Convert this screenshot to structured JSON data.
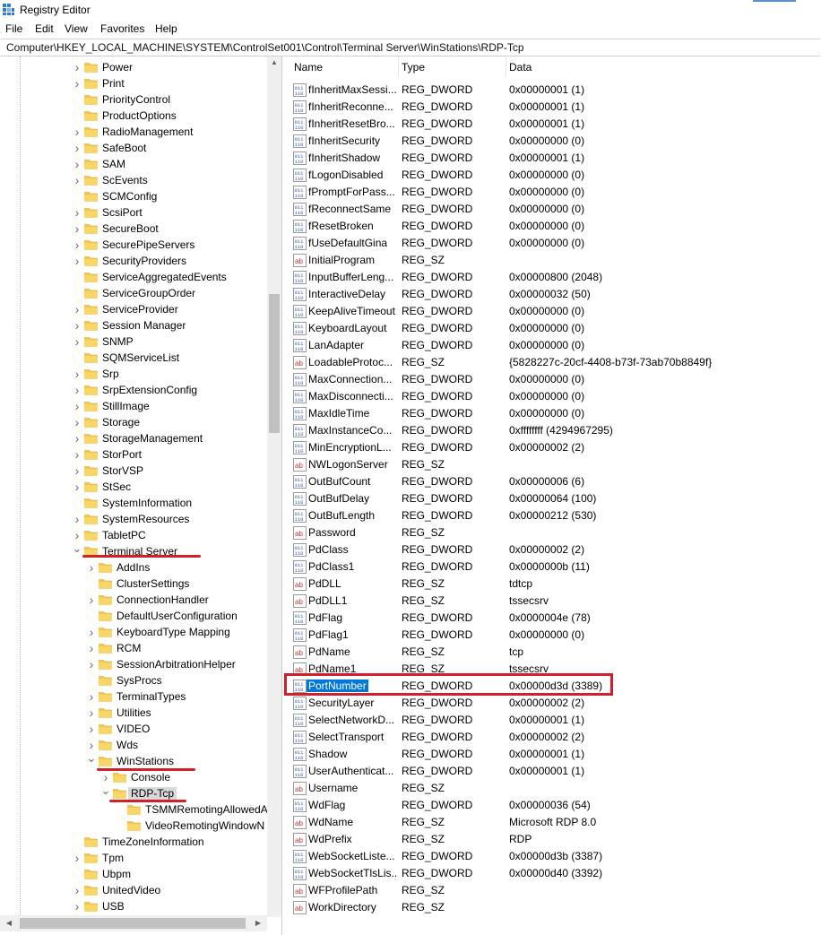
{
  "window": {
    "title": "Registry Editor"
  },
  "menu": [
    "File",
    "Edit",
    "View",
    "Favorites",
    "Help"
  ],
  "address": "Computer\\HKEY_LOCAL_MACHINE\\SYSTEM\\ControlSet001\\Control\\Terminal Server\\WinStations\\RDP-Tcp",
  "tree": [
    {
      "label": "Power",
      "level": 0,
      "chev": "right"
    },
    {
      "label": "Print",
      "level": 0,
      "chev": "right"
    },
    {
      "label": "PriorityControl",
      "level": 0,
      "chev": "none"
    },
    {
      "label": "ProductOptions",
      "level": 0,
      "chev": "none"
    },
    {
      "label": "RadioManagement",
      "level": 0,
      "chev": "right"
    },
    {
      "label": "SafeBoot",
      "level": 0,
      "chev": "right"
    },
    {
      "label": "SAM",
      "level": 0,
      "chev": "right"
    },
    {
      "label": "ScEvents",
      "level": 0,
      "chev": "right"
    },
    {
      "label": "SCMConfig",
      "level": 0,
      "chev": "none"
    },
    {
      "label": "ScsiPort",
      "level": 0,
      "chev": "right"
    },
    {
      "label": "SecureBoot",
      "level": 0,
      "chev": "right"
    },
    {
      "label": "SecurePipeServers",
      "level": 0,
      "chev": "right"
    },
    {
      "label": "SecurityProviders",
      "level": 0,
      "chev": "right"
    },
    {
      "label": "ServiceAggregatedEvents",
      "level": 0,
      "chev": "none"
    },
    {
      "label": "ServiceGroupOrder",
      "level": 0,
      "chev": "none"
    },
    {
      "label": "ServiceProvider",
      "level": 0,
      "chev": "right"
    },
    {
      "label": "Session Manager",
      "level": 0,
      "chev": "right"
    },
    {
      "label": "SNMP",
      "level": 0,
      "chev": "right"
    },
    {
      "label": "SQMServiceList",
      "level": 0,
      "chev": "none"
    },
    {
      "label": "Srp",
      "level": 0,
      "chev": "right"
    },
    {
      "label": "SrpExtensionConfig",
      "level": 0,
      "chev": "right"
    },
    {
      "label": "StillImage",
      "level": 0,
      "chev": "right"
    },
    {
      "label": "Storage",
      "level": 0,
      "chev": "right"
    },
    {
      "label": "StorageManagement",
      "level": 0,
      "chev": "right"
    },
    {
      "label": "StorPort",
      "level": 0,
      "chev": "right"
    },
    {
      "label": "StorVSP",
      "level": 0,
      "chev": "right"
    },
    {
      "label": "StSec",
      "level": 0,
      "chev": "right"
    },
    {
      "label": "SystemInformation",
      "level": 0,
      "chev": "none"
    },
    {
      "label": "SystemResources",
      "level": 0,
      "chev": "right"
    },
    {
      "label": "TabletPC",
      "level": 0,
      "chev": "right"
    },
    {
      "label": "Terminal Server",
      "level": 0,
      "chev": "down"
    },
    {
      "label": "AddIns",
      "level": 1,
      "chev": "right"
    },
    {
      "label": "ClusterSettings",
      "level": 1,
      "chev": "none"
    },
    {
      "label": "ConnectionHandler",
      "level": 1,
      "chev": "right"
    },
    {
      "label": "DefaultUserConfiguration",
      "level": 1,
      "chev": "none"
    },
    {
      "label": "KeyboardType Mapping",
      "level": 1,
      "chev": "right"
    },
    {
      "label": "RCM",
      "level": 1,
      "chev": "right"
    },
    {
      "label": "SessionArbitrationHelper",
      "level": 1,
      "chev": "right"
    },
    {
      "label": "SysProcs",
      "level": 1,
      "chev": "none"
    },
    {
      "label": "TerminalTypes",
      "level": 1,
      "chev": "right"
    },
    {
      "label": "Utilities",
      "level": 1,
      "chev": "right"
    },
    {
      "label": "VIDEO",
      "level": 1,
      "chev": "right"
    },
    {
      "label": "Wds",
      "level": 1,
      "chev": "right"
    },
    {
      "label": "WinStations",
      "level": 1,
      "chev": "down"
    },
    {
      "label": "Console",
      "level": 2,
      "chev": "right"
    },
    {
      "label": "RDP-Tcp",
      "level": 2,
      "chev": "down",
      "selected": true
    },
    {
      "label": "TSMMRemotingAllowedA",
      "level": 3,
      "chev": "none"
    },
    {
      "label": "VideoRemotingWindowN",
      "level": 3,
      "chev": "none"
    },
    {
      "label": "TimeZoneInformation",
      "level": 0,
      "chev": "none"
    },
    {
      "label": "Tpm",
      "level": 0,
      "chev": "right"
    },
    {
      "label": "Ubpm",
      "level": 0,
      "chev": "none"
    },
    {
      "label": "UnitedVideo",
      "level": 0,
      "chev": "right"
    },
    {
      "label": "USB",
      "level": 0,
      "chev": "right"
    }
  ],
  "columns": {
    "name": "Name",
    "type": "Type",
    "data": "Data"
  },
  "values": [
    {
      "name": "fInheritMaxSessi...",
      "type": "REG_DWORD",
      "data": "0x00000001 (1)",
      "icon": "dword-icon"
    },
    {
      "name": "fInheritReconne...",
      "type": "REG_DWORD",
      "data": "0x00000001 (1)",
      "icon": "dword-icon"
    },
    {
      "name": "fInheritResetBro...",
      "type": "REG_DWORD",
      "data": "0x00000001 (1)",
      "icon": "dword-icon"
    },
    {
      "name": "fInheritSecurity",
      "type": "REG_DWORD",
      "data": "0x00000000 (0)",
      "icon": "dword-icon"
    },
    {
      "name": "fInheritShadow",
      "type": "REG_DWORD",
      "data": "0x00000001 (1)",
      "icon": "dword-icon"
    },
    {
      "name": "fLogonDisabled",
      "type": "REG_DWORD",
      "data": "0x00000000 (0)",
      "icon": "dword-icon"
    },
    {
      "name": "fPromptForPass...",
      "type": "REG_DWORD",
      "data": "0x00000000 (0)",
      "icon": "dword-icon"
    },
    {
      "name": "fReconnectSame",
      "type": "REG_DWORD",
      "data": "0x00000000 (0)",
      "icon": "dword-icon"
    },
    {
      "name": "fResetBroken",
      "type": "REG_DWORD",
      "data": "0x00000000 (0)",
      "icon": "dword-icon"
    },
    {
      "name": "fUseDefaultGina",
      "type": "REG_DWORD",
      "data": "0x00000000 (0)",
      "icon": "dword-icon"
    },
    {
      "name": "InitialProgram",
      "type": "REG_SZ",
      "data": "",
      "icon": "string-icon"
    },
    {
      "name": "InputBufferLeng...",
      "type": "REG_DWORD",
      "data": "0x00000800 (2048)",
      "icon": "dword-icon"
    },
    {
      "name": "InteractiveDelay",
      "type": "REG_DWORD",
      "data": "0x00000032 (50)",
      "icon": "dword-icon"
    },
    {
      "name": "KeepAliveTimeout",
      "type": "REG_DWORD",
      "data": "0x00000000 (0)",
      "icon": "dword-icon"
    },
    {
      "name": "KeyboardLayout",
      "type": "REG_DWORD",
      "data": "0x00000000 (0)",
      "icon": "dword-icon"
    },
    {
      "name": "LanAdapter",
      "type": "REG_DWORD",
      "data": "0x00000000 (0)",
      "icon": "dword-icon"
    },
    {
      "name": "LoadableProtoc...",
      "type": "REG_SZ",
      "data": "{5828227c-20cf-4408-b73f-73ab70b8849f}",
      "icon": "string-icon"
    },
    {
      "name": "MaxConnection...",
      "type": "REG_DWORD",
      "data": "0x00000000 (0)",
      "icon": "dword-icon"
    },
    {
      "name": "MaxDisconnecti...",
      "type": "REG_DWORD",
      "data": "0x00000000 (0)",
      "icon": "dword-icon"
    },
    {
      "name": "MaxIdleTime",
      "type": "REG_DWORD",
      "data": "0x00000000 (0)",
      "icon": "dword-icon"
    },
    {
      "name": "MaxInstanceCo...",
      "type": "REG_DWORD",
      "data": "0xffffffff (4294967295)",
      "icon": "dword-icon"
    },
    {
      "name": "MinEncryptionL...",
      "type": "REG_DWORD",
      "data": "0x00000002 (2)",
      "icon": "dword-icon"
    },
    {
      "name": "NWLogonServer",
      "type": "REG_SZ",
      "data": "",
      "icon": "string-icon"
    },
    {
      "name": "OutBufCount",
      "type": "REG_DWORD",
      "data": "0x00000006 (6)",
      "icon": "dword-icon"
    },
    {
      "name": "OutBufDelay",
      "type": "REG_DWORD",
      "data": "0x00000064 (100)",
      "icon": "dword-icon"
    },
    {
      "name": "OutBufLength",
      "type": "REG_DWORD",
      "data": "0x00000212 (530)",
      "icon": "dword-icon"
    },
    {
      "name": "Password",
      "type": "REG_SZ",
      "data": "",
      "icon": "string-icon"
    },
    {
      "name": "PdClass",
      "type": "REG_DWORD",
      "data": "0x00000002 (2)",
      "icon": "dword-icon"
    },
    {
      "name": "PdClass1",
      "type": "REG_DWORD",
      "data": "0x0000000b (11)",
      "icon": "dword-icon"
    },
    {
      "name": "PdDLL",
      "type": "REG_SZ",
      "data": "tdtcp",
      "icon": "string-icon"
    },
    {
      "name": "PdDLL1",
      "type": "REG_SZ",
      "data": "tssecsrv",
      "icon": "string-icon"
    },
    {
      "name": "PdFlag",
      "type": "REG_DWORD",
      "data": "0x0000004e (78)",
      "icon": "dword-icon"
    },
    {
      "name": "PdFlag1",
      "type": "REG_DWORD",
      "data": "0x00000000 (0)",
      "icon": "dword-icon"
    },
    {
      "name": "PdName",
      "type": "REG_SZ",
      "data": "tcp",
      "icon": "string-icon"
    },
    {
      "name": "PdName1",
      "type": "REG_SZ",
      "data": "tssecsrv",
      "icon": "string-icon"
    },
    {
      "name": "PortNumber",
      "type": "REG_DWORD",
      "data": "0x00000d3d (3389)",
      "icon": "dword-icon",
      "selected": true
    },
    {
      "name": "SecurityLayer",
      "type": "REG_DWORD",
      "data": "0x00000002 (2)",
      "icon": "dword-icon"
    },
    {
      "name": "SelectNetworkD...",
      "type": "REG_DWORD",
      "data": "0x00000001 (1)",
      "icon": "dword-icon"
    },
    {
      "name": "SelectTransport",
      "type": "REG_DWORD",
      "data": "0x00000002 (2)",
      "icon": "dword-icon"
    },
    {
      "name": "Shadow",
      "type": "REG_DWORD",
      "data": "0x00000001 (1)",
      "icon": "dword-icon"
    },
    {
      "name": "UserAuthenticat...",
      "type": "REG_DWORD",
      "data": "0x00000001 (1)",
      "icon": "dword-icon"
    },
    {
      "name": "Username",
      "type": "REG_SZ",
      "data": "",
      "icon": "string-icon"
    },
    {
      "name": "WdFlag",
      "type": "REG_DWORD",
      "data": "0x00000036 (54)",
      "icon": "dword-icon"
    },
    {
      "name": "WdName",
      "type": "REG_SZ",
      "data": "Microsoft RDP 8.0",
      "icon": "string-icon"
    },
    {
      "name": "WdPrefix",
      "type": "REG_SZ",
      "data": "RDP",
      "icon": "string-icon"
    },
    {
      "name": "WebSocketListe...",
      "type": "REG_DWORD",
      "data": "0x00000d3b (3387)",
      "icon": "dword-icon"
    },
    {
      "name": "WebSocketTlsLis...",
      "type": "REG_DWORD",
      "data": "0x00000d40 (3392)",
      "icon": "dword-icon"
    },
    {
      "name": "WFProfilePath",
      "type": "REG_SZ",
      "data": "",
      "icon": "string-icon"
    },
    {
      "name": "WorkDirectory",
      "type": "REG_SZ",
      "data": "",
      "icon": "string-icon"
    }
  ],
  "colors": {
    "selection": "#0078d7",
    "annotation_red": "#d0202a",
    "folder": "#f4c74a",
    "dword_icon": "#2a5db0",
    "string_icon": "#c0392b"
  }
}
